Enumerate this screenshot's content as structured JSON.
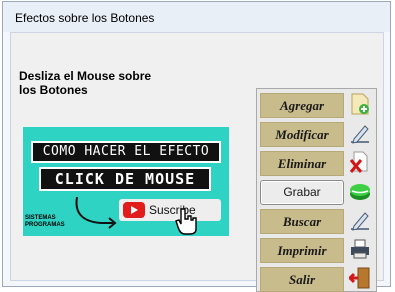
{
  "window": {
    "title": "Efectos sobre los Botones"
  },
  "info": {
    "line1": "Desliza el Mouse sobre",
    "line2": "los Botones"
  },
  "thumbnail": {
    "line1": "COMO HACER EL EFECTO",
    "line2": "CLICK DE MOUSE",
    "subscribe": "Suscribe",
    "brand": "SISTEMAS PROGRAMAS"
  },
  "buttons": [
    {
      "label": "Agregar",
      "icon": "add-document-icon"
    },
    {
      "label": "Modificar",
      "icon": "edit-pencil-icon"
    },
    {
      "label": "Eliminar",
      "icon": "delete-document-icon"
    },
    {
      "label": "Grabar",
      "icon": "save-disk-icon"
    },
    {
      "label": "Buscar",
      "icon": "search-pencil-icon"
    },
    {
      "label": "Imprimir",
      "icon": "printer-icon"
    },
    {
      "label": "Salir",
      "icon": "exit-door-icon"
    }
  ],
  "colors": {
    "button_fill": "#c9bc8c",
    "panel_bg": "#e9e9e9",
    "thumbnail_bg": "#2ed3c3"
  }
}
